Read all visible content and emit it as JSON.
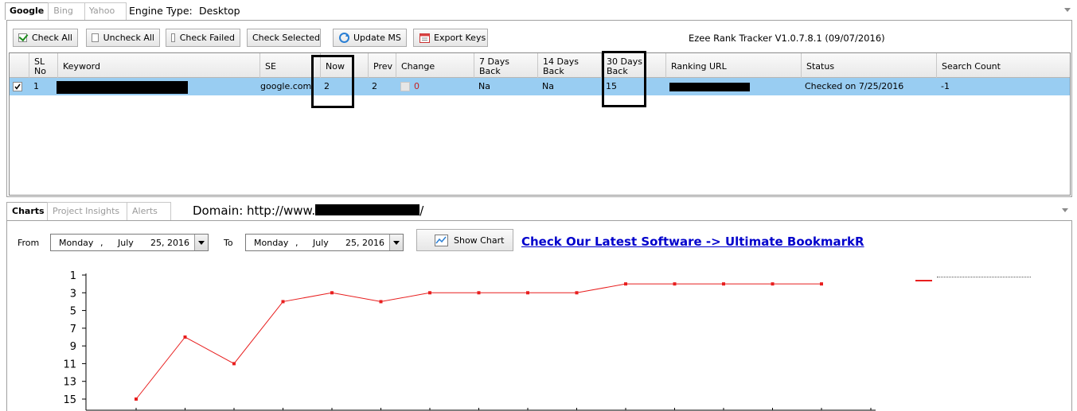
{
  "engine_tabs": [
    "Google",
    "Bing",
    "Yahoo"
  ],
  "engine_type": {
    "label": "Engine Type:",
    "value": "Desktop"
  },
  "toolbar": {
    "check_all": "Check All",
    "uncheck_all": "Uncheck All",
    "check_failed": "Check Failed",
    "check_selected": "Check Selected",
    "update_ms": "Update MS",
    "export_keys": "Export Keys"
  },
  "app_title": "Ezee Rank Tracker V1.0.7.8.1 (09/07/2016)",
  "columns": {
    "sl_no": "SL No",
    "keyword": "Keyword",
    "se": "SE",
    "now": "Now",
    "prev": "Prev",
    "change": "Change",
    "days7": "7 Days Back",
    "days14": "14 Days Back",
    "days30": "30 Days Back",
    "ranking_url": "Ranking URL",
    "status": "Status",
    "search_count": "Search Count"
  },
  "row": {
    "sl_no": "1",
    "se": "google.com",
    "now": "2",
    "prev": "2",
    "change": "0",
    "days7": "Na",
    "days14": "Na",
    "days30": "15",
    "status": "Checked on 7/25/2016",
    "search_count": "-1"
  },
  "bottom_tabs": [
    "Charts",
    "Project Insights",
    "Alerts"
  ],
  "domain_label": "Domain: http://www.",
  "domain_suffix": "/",
  "date_range": {
    "from_label": "From",
    "to_label": "To",
    "from": {
      "weekday": "Monday",
      "month": "July",
      "day_year": "25, 2016"
    },
    "to": {
      "weekday": "Monday",
      "month": "July",
      "day_year": "25, 2016"
    }
  },
  "show_chart": "Show Chart",
  "promo_link": "Check Our Latest Software -> Ultimate BookmarkR",
  "accent_color": "#e81e1e",
  "selection_color": "#99cdf2",
  "chart_data": {
    "type": "line",
    "title": "",
    "xlabel": "",
    "ylabel": "",
    "y_inverted": true,
    "ylim": [
      1,
      15
    ],
    "y_ticks": [
      1,
      3,
      5,
      7,
      9,
      11,
      13,
      15
    ],
    "series": [
      {
        "values": [
          15,
          8,
          11,
          4,
          3,
          4,
          3,
          3,
          3,
          3,
          2,
          2,
          2,
          2,
          2
        ]
      }
    ],
    "legend_position": "top-right",
    "color": "#e81e1e"
  }
}
